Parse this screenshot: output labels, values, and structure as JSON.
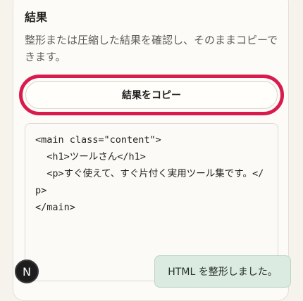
{
  "section": {
    "title": "結果",
    "description": "整形または圧縮した結果を確認し、そのままコピーできます。"
  },
  "actions": {
    "copy_label": "結果をコピー"
  },
  "output": {
    "code": "<main class=\"content\">\n  <h1>ツールさん</h1>\n  <p>すぐ使えて、すぐ片付く実用ツール集です。</p>\n</main>"
  },
  "avatar": {
    "letter": "N"
  },
  "toast": {
    "message": "HTML を整形しました。"
  }
}
